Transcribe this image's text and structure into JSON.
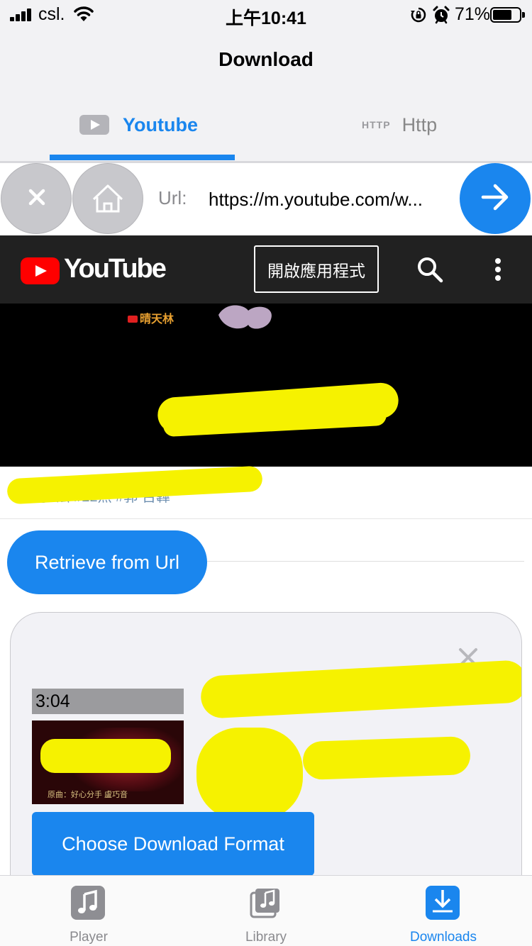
{
  "status_bar": {
    "carrier": "csl.",
    "time": "上午10:41",
    "battery_percent": "71%",
    "battery_level": 0.71
  },
  "header": {
    "title": "Download",
    "tabs": [
      {
        "label": "Youtube",
        "icon": "youtube-play-icon",
        "active": true
      },
      {
        "label": "Http",
        "tag": "HTTP",
        "active": false
      }
    ]
  },
  "url_bar": {
    "label": "Url:",
    "value": "https://m.youtube.com/w..."
  },
  "youtube_page": {
    "logo_text": "YouTube",
    "open_app_label": "開啟應用程式",
    "channel_watermark": "晴天林",
    "hashtags": "#星宇 法  #22然  #郭 召韡"
  },
  "retrieve_button": "Retrieve from Url",
  "result_card": {
    "duration": "3:04",
    "thumbnail_caption": "原曲：好心分手  盧巧音",
    "choose_format_label": "Choose Download Format"
  },
  "tab_bar": {
    "items": [
      {
        "label": "Player",
        "icon": "music-note-icon"
      },
      {
        "label": "Library",
        "icon": "library-icon"
      },
      {
        "label": "Downloads",
        "icon": "download-icon",
        "active": true
      }
    ]
  },
  "colors": {
    "accent": "#1a86ee",
    "youtube_red": "#ff0000",
    "redaction": "#f6f200"
  }
}
